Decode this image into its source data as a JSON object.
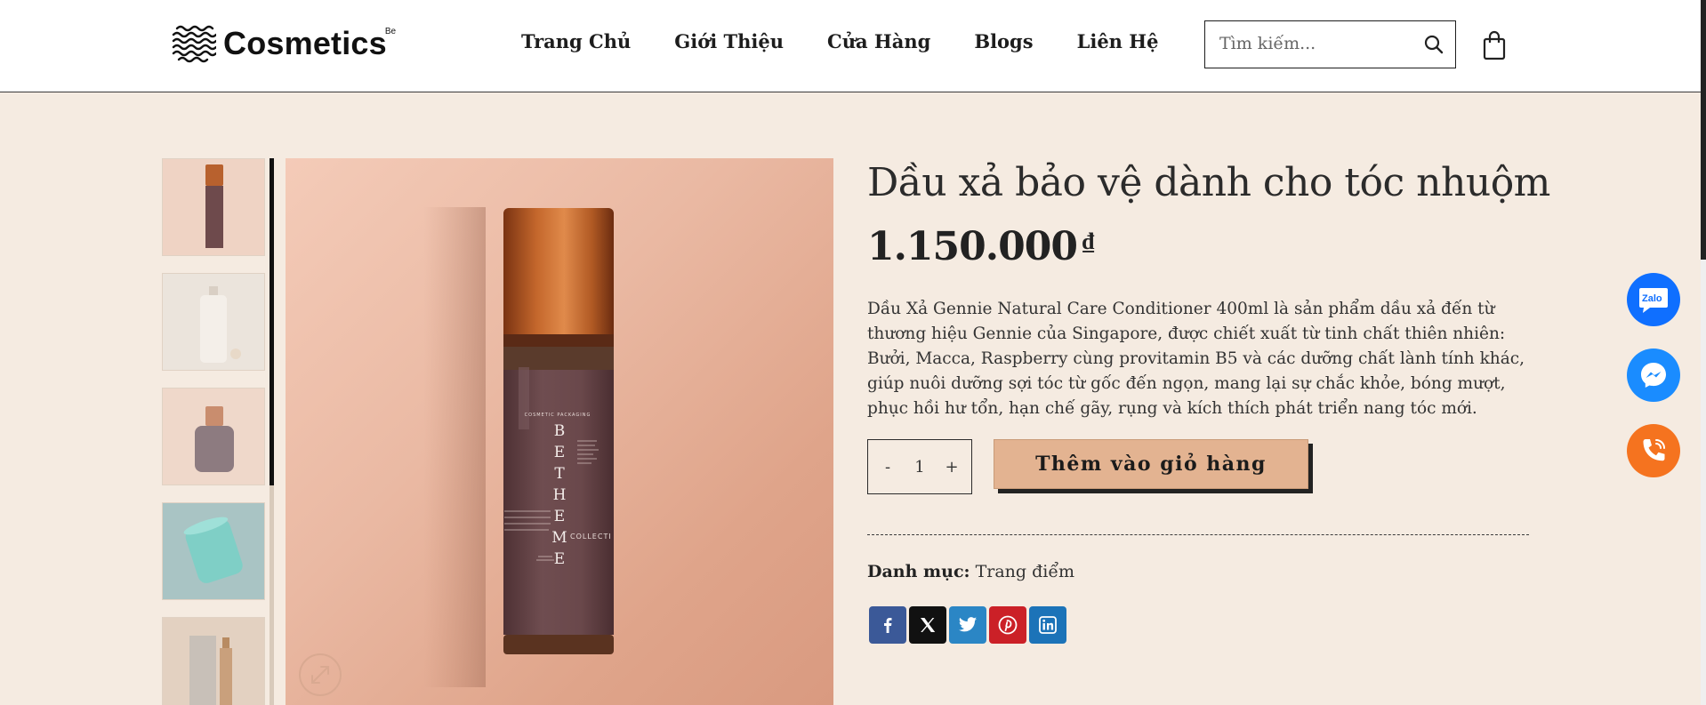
{
  "brand": {
    "name": "Cosmetics",
    "superscript": "Be"
  },
  "nav": {
    "items": [
      "Trang Chủ",
      "Giới Thiệu",
      "Cửa Hàng",
      "Blogs",
      "Liên Hệ"
    ]
  },
  "search": {
    "placeholder": "Tìm kiếm..."
  },
  "product": {
    "title": "Dầu xả bảo vệ dành cho tóc nhuộm",
    "price": "1.150.000",
    "currency": "₫",
    "description": "Dầu Xả Gennie Natural Care Conditioner 400ml là sản phẩm dầu xả đến từ thương hiệu Gennie của Singapore, được chiết xuất từ tinh chất thiên nhiên: Bưởi, Macca, Raspberry cùng provitamin B5 và các dưỡng chất lành tính khác, giúp nuôi dưỡng sợi tóc từ gốc đến ngọn, mang lại sự chắc khỏe, bóng mượt, phục hồi hư tổn, hạn chế gãy, rụng và kích thích phát triển nang tóc mới.",
    "quantity": {
      "minus": "-",
      "value": "1",
      "plus": "+"
    },
    "add_to_cart_label": "Thêm vào giỏ hàng",
    "category_label": "Danh mục:",
    "category_value": "Trang điểm"
  },
  "bottle": {
    "header": "COSMETIC   PACKAGING",
    "letters": [
      "B",
      "E",
      "T",
      "H",
      "E",
      "M",
      "E"
    ],
    "collection": "COLLECTI"
  },
  "share": [
    "facebook-icon",
    "x-icon",
    "twitter-icon",
    "pinterest-icon",
    "linkedin-icon"
  ],
  "floating": {
    "zalo_label": "Zalo"
  },
  "colors": {
    "page_bg": "#f5ebe1",
    "button_bg": "#e3b391",
    "zalo": "#0f6fff",
    "messenger": "#1a8cff",
    "phone": "#f5731f"
  }
}
